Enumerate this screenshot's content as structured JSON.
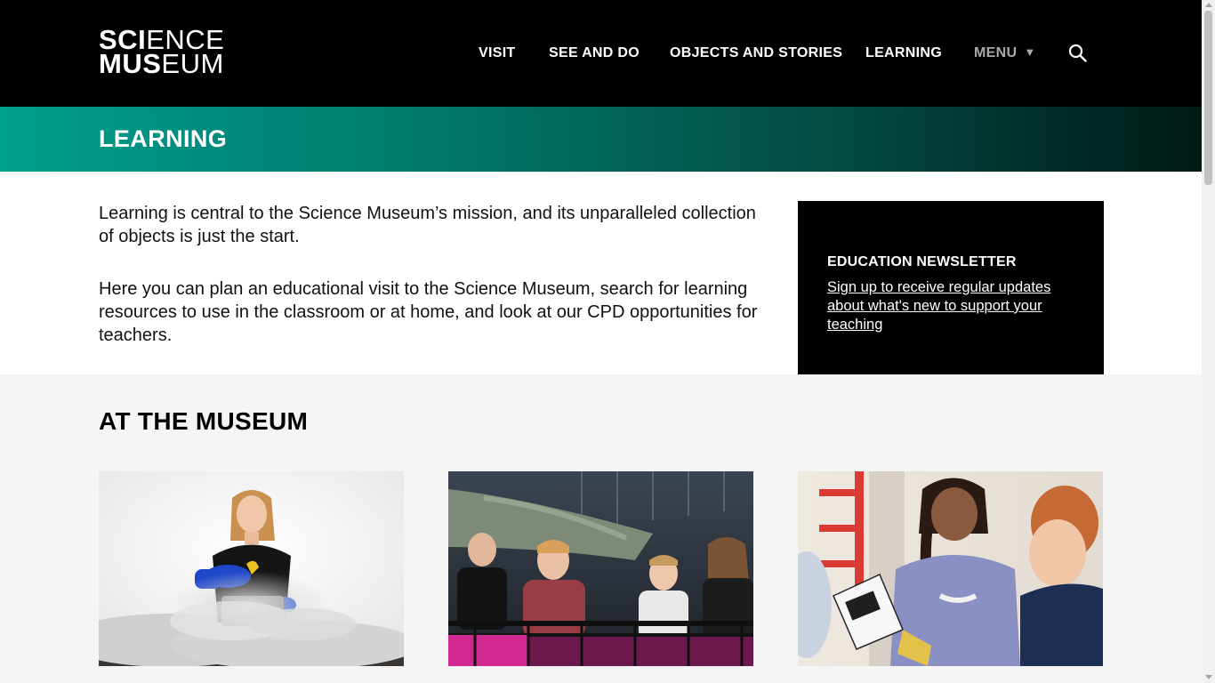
{
  "header": {
    "logo_line1_bold": "SCI",
    "logo_line1_rest": "ENCE",
    "logo_line2_bold": "MUS",
    "logo_line2_rest": "EUM",
    "nav": [
      {
        "label": "VISIT"
      },
      {
        "label": "SEE AND DO"
      },
      {
        "label": "OBJECTS AND STORIES"
      },
      {
        "label": "LEARNING"
      }
    ],
    "menu_label": "MENU",
    "menu_caret": "▼",
    "search_icon": "search-icon"
  },
  "page_title": "LEARNING",
  "intro": {
    "paragraph1": "Learning is central to the Science Museum’s mission, and its unparalleled collection of objects is just the start.",
    "paragraph2": "Here you can plan an educational visit to the Science Museum, search for learning resources to use in the classroom or at home, and look at our CPD opportunities for teachers."
  },
  "newsletter": {
    "heading": "EDUCATION NEWSLETTER",
    "link": "Sign up to receive regular updates about what's new to support your teaching"
  },
  "at_the_museum": {
    "title": "AT THE MUSEUM"
  },
  "colors": {
    "header_bg": "#000000",
    "band_start": "#009e8c",
    "band_end": "#001a16",
    "section_bg": "#f5f5f5"
  }
}
